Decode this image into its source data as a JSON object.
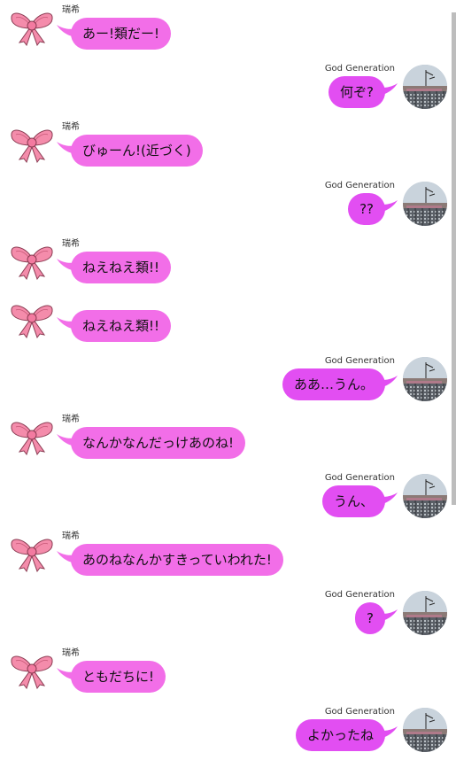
{
  "colors": {
    "left_bubble": "#f26ee8",
    "right_bubble": "#e24ef2",
    "background": "#ffffff"
  },
  "icons": {
    "left_avatar": "pink-ribbon-bow-icon",
    "right_avatar": "building-photo-avatar"
  },
  "messages": [
    {
      "side": "left",
      "sender": "瑞希",
      "text": "あー!類だー!"
    },
    {
      "side": "right",
      "sender": "God Generation",
      "text": "何ぞ?"
    },
    {
      "side": "left",
      "sender": "瑞希",
      "text": "びゅーん!(近づく)"
    },
    {
      "side": "right",
      "sender": "God Generation",
      "text": "??"
    },
    {
      "side": "left",
      "sender": "瑞希",
      "text": "ねえねえ類!!"
    },
    {
      "side": "left",
      "sender": "",
      "text": "ねえねえ類!!"
    },
    {
      "side": "right",
      "sender": "God Generation",
      "text": "ああ…うん。"
    },
    {
      "side": "left",
      "sender": "瑞希",
      "text": "なんかなんだっけあのね!"
    },
    {
      "side": "right",
      "sender": "God Generation",
      "text": "うん、"
    },
    {
      "side": "left",
      "sender": "瑞希",
      "text": "あのねなんかすきっていわれた!"
    },
    {
      "side": "right",
      "sender": "God Generation",
      "text": "?"
    },
    {
      "side": "left",
      "sender": "瑞希",
      "text": "ともだちに!"
    },
    {
      "side": "right",
      "sender": "God Generation",
      "text": "よかったね"
    }
  ]
}
